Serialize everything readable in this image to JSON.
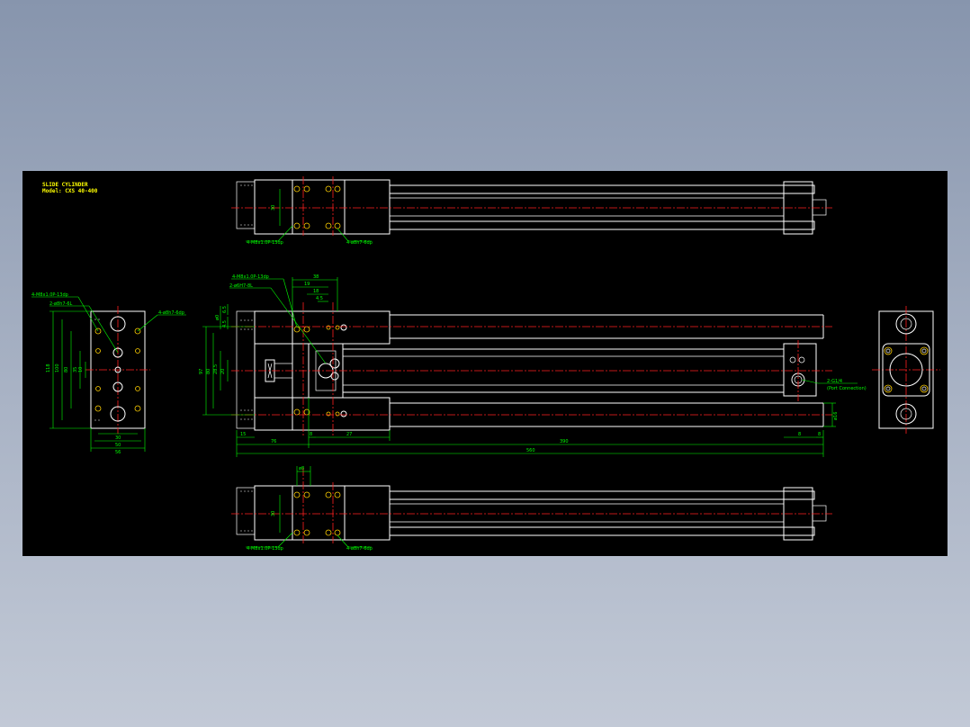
{
  "title_block": {
    "line1": "SLIDE CYLINDER",
    "line2": "Model: CXS 40-400"
  },
  "colors": {
    "background": "#000000",
    "outline": "#ffffff",
    "centerline": "#ff2020",
    "dimension": "#00ff00",
    "title": "#ffff00",
    "hole": "#ffd000"
  },
  "top_view": {
    "dim_v": "30",
    "callout_left": "4-M8x1.0P-13dp",
    "callout_right": "4-ø8h7-6dp"
  },
  "main_view": {
    "callout_top": "4-M8x1.0P-13dp",
    "callout_pin": "2-ø6H7-8L",
    "dims_top": [
      "38",
      "19",
      "18",
      "4.5"
    ],
    "dims_left_small": [
      "6.5",
      "ø0",
      "4.5"
    ],
    "dims_left": [
      "97",
      "80",
      "28.5",
      "20"
    ],
    "dims_bottom": [
      "15",
      "76",
      "8",
      "27",
      "560",
      "390",
      "8",
      "8"
    ],
    "dim_right_v": "ø16",
    "callout_port": "2-G1/4",
    "callout_port_sub": "(Port Connection)"
  },
  "bottom_view": {
    "dim_top": "ø8",
    "dim_v": "30",
    "callout_left": "4-M8x1.0P-13dp",
    "callout_right": "4-ø8h7-6dp"
  },
  "left_view": {
    "callout_top": "4-M8x1.0P-13dp",
    "callout_pin": "2-ø8h7-6L",
    "callout_right": "4-ø8h7-6dp",
    "dims_v": [
      "118",
      "100",
      "80",
      "35",
      "10"
    ],
    "dims_h": [
      "30",
      "50",
      "56"
    ]
  }
}
